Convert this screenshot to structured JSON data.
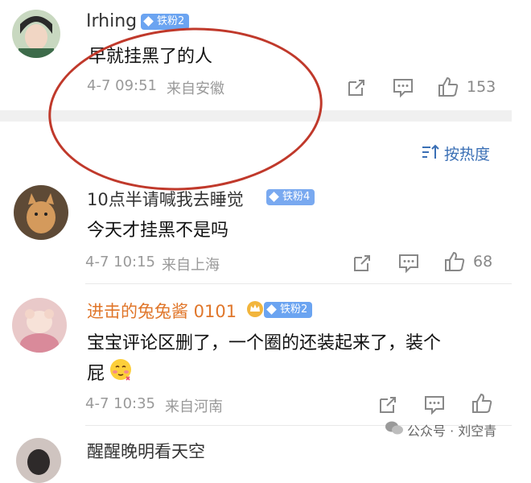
{
  "comments": [
    {
      "username": "Irhing",
      "badge": "铁粉2",
      "text": "早就挂黑了的人",
      "time": "4-7 09:51",
      "location": "来自安徽",
      "likes": "153"
    },
    {
      "username": "10点半请喊我去睡觉",
      "badge": "铁粉4",
      "text": "今天才挂黑不是吗",
      "time": "4-7 10:15",
      "location": "来自上海",
      "likes": "68"
    },
    {
      "username": "进击的兔兔酱 0101",
      "badge": "铁粉2",
      "text_line1": "宝宝评论区删了，一个圈的还装起来了，装个",
      "text_line2": "屁",
      "time": "4-7 10:35",
      "location": "来自河南",
      "likes": ""
    },
    {
      "username": "醒醒晚明看天空"
    }
  ],
  "sort_label": "按热度",
  "watermark": "公众号 · 刘空青",
  "colors": {
    "badge": "#6ba4f1",
    "vip_name": "#e0762a",
    "sort": "#3a6fb5",
    "annotation": "#c0392b"
  },
  "icons": {
    "share": "share-icon",
    "comment": "comment-icon",
    "like": "thumbs-up-icon",
    "sort": "sort-icon",
    "emoji": "blush-emoji"
  }
}
